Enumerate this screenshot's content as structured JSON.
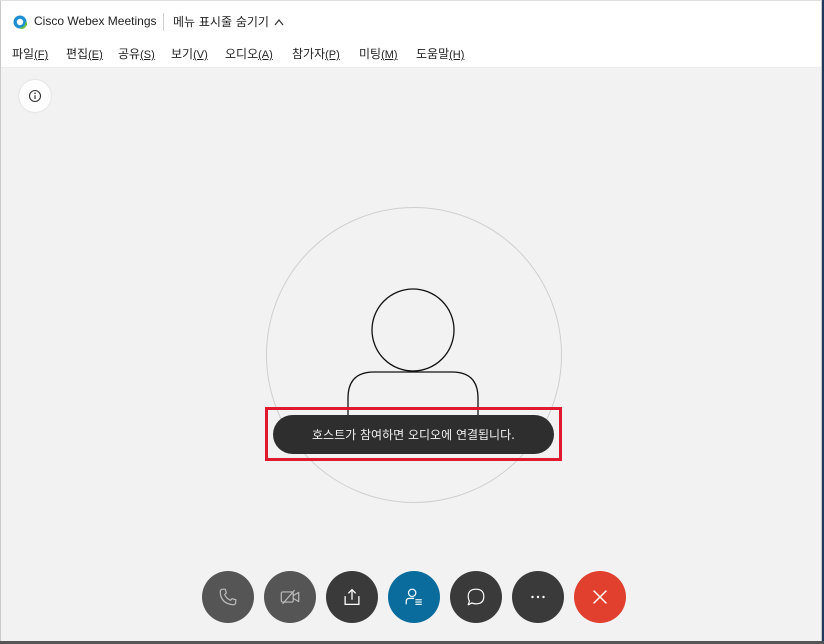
{
  "titlebar": {
    "app_name": "Cisco Webex Meetings",
    "menu_toggle_label": "메뉴 표시줄 숨기기"
  },
  "menu": {
    "items": [
      {
        "label": "파일",
        "accel": "(F)"
      },
      {
        "label": "편집",
        "accel": "(E)"
      },
      {
        "label": "공유",
        "accel": "(S)"
      },
      {
        "label": "보기",
        "accel": "(V)"
      },
      {
        "label": "오디오",
        "accel": "(A)"
      },
      {
        "label": "참가자",
        "accel": "(P)"
      },
      {
        "label": "미팅",
        "accel": "(M)"
      },
      {
        "label": "도움말",
        "accel": "(H)"
      }
    ]
  },
  "stage": {
    "toast_message": "호스트가 참여하면 오디오에 연결됩니다."
  },
  "controls": {
    "icons": [
      "phone-icon",
      "video-off-icon",
      "share-icon",
      "participants-icon",
      "chat-icon",
      "more-icon",
      "end-call-icon"
    ]
  },
  "colors": {
    "window_bg": "#f2f2f2",
    "control_grey": "#4a4a4a",
    "participants_active": "#0a6c9c",
    "end_call": "#e0402d",
    "highlight": "#e0192e",
    "toast_bg": "#2e2e2e"
  }
}
